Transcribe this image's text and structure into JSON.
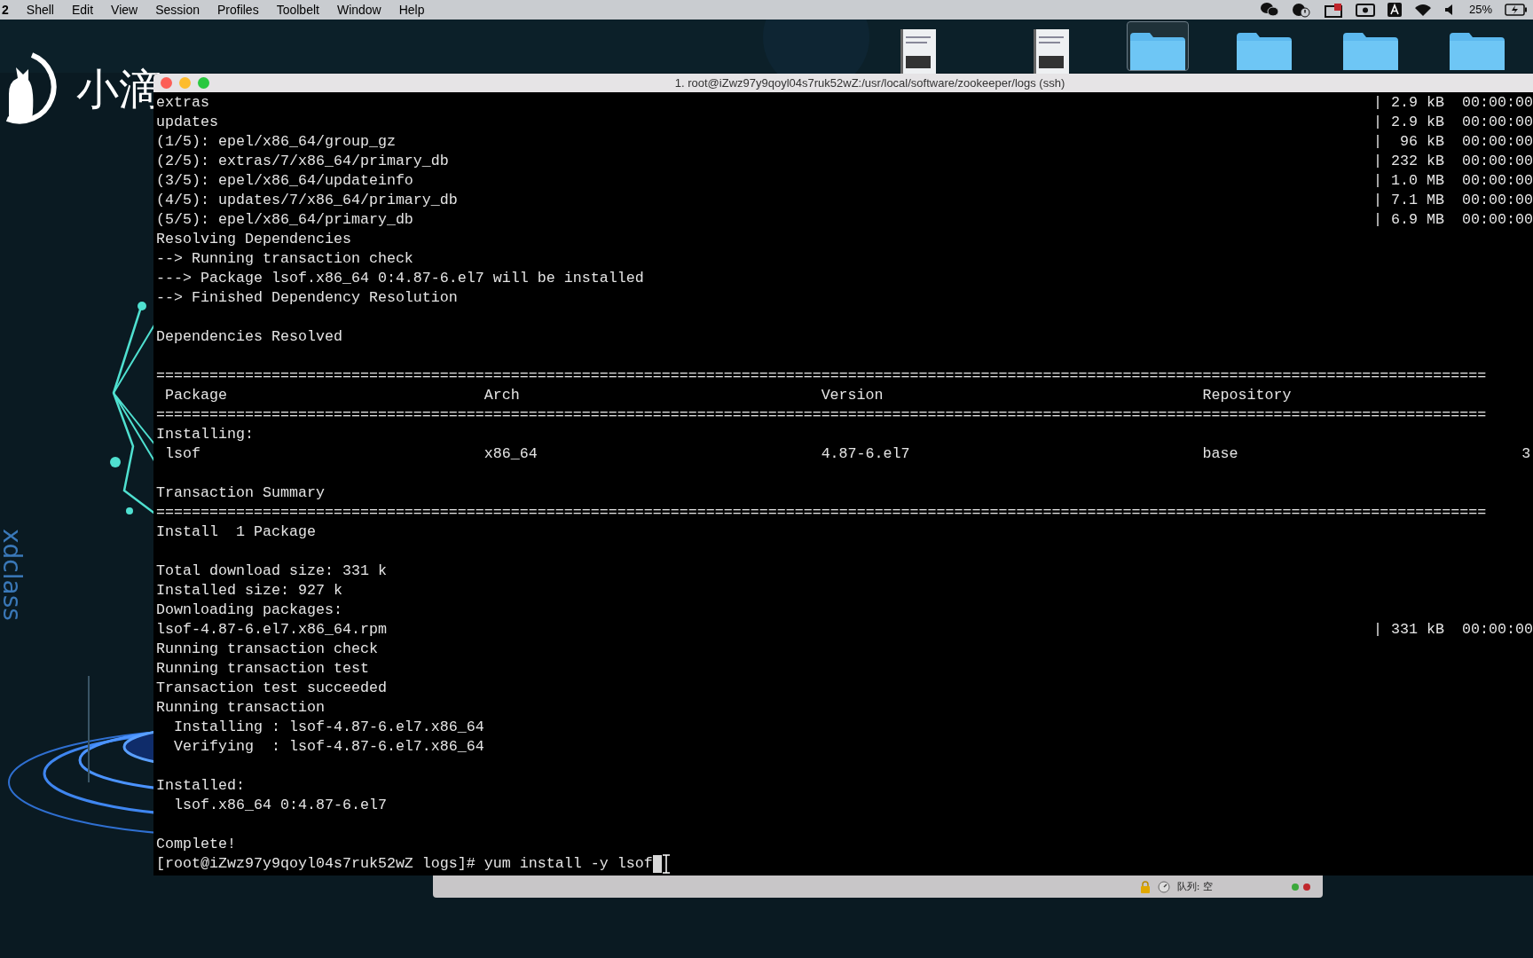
{
  "menu_bar": {
    "app_fragment": "2",
    "menus": [
      "Shell",
      "Edit",
      "View",
      "Session",
      "Profiles",
      "Toolbelt",
      "Window",
      "Help"
    ],
    "battery": "25%"
  },
  "desktop": {
    "logo_text": "小滴",
    "side_text": "xdclass",
    "icons": [
      {
        "kind": "document",
        "selected": false
      },
      {
        "kind": "document",
        "selected": false
      },
      {
        "kind": "folder",
        "selected": true
      },
      {
        "kind": "folder",
        "selected": false
      },
      {
        "kind": "folder",
        "selected": false
      },
      {
        "kind": "folder",
        "selected": false
      }
    ]
  },
  "terminal": {
    "title": "1. root@iZwz97y9qoyl04s7ruk52wZ:/usr/local/software/zookeeper/logs (ssh)",
    "lines": [
      {
        "kind": "text",
        "text": "extras",
        "right": "| 2.9 kB  00:00:00"
      },
      {
        "kind": "text",
        "text": "updates",
        "right": "| 2.9 kB  00:00:00"
      },
      {
        "kind": "text",
        "text": "(1/5): epel/x86_64/group_gz",
        "right": "|  96 kB  00:00:00"
      },
      {
        "kind": "text",
        "text": "(2/5): extras/7/x86_64/primary_db",
        "right": "| 232 kB  00:00:00"
      },
      {
        "kind": "text",
        "text": "(3/5): epel/x86_64/updateinfo",
        "right": "| 1.0 MB  00:00:00"
      },
      {
        "kind": "text",
        "text": "(4/5): updates/7/x86_64/primary_db",
        "right": "| 7.1 MB  00:00:00"
      },
      {
        "kind": "text",
        "text": "(5/5): epel/x86_64/primary_db",
        "right": "| 6.9 MB  00:00:00"
      },
      {
        "kind": "text",
        "text": "Resolving Dependencies"
      },
      {
        "kind": "text",
        "text": "--> Running transaction check"
      },
      {
        "kind": "text",
        "text": "---> Package lsof.x86_64 0:4.87-6.el7 will be installed"
      },
      {
        "kind": "text",
        "text": "--> Finished Dependency Resolution"
      },
      {
        "kind": "blank"
      },
      {
        "kind": "text",
        "text": "Dependencies Resolved"
      },
      {
        "kind": "blank"
      },
      {
        "kind": "text",
        "text": "======================================================================================================================================================"
      },
      {
        "kind": "row",
        "cells": [
          "Package",
          "Arch",
          "Version",
          "Repository"
        ]
      },
      {
        "kind": "text",
        "text": "======================================================================================================================================================"
      },
      {
        "kind": "text",
        "text": "Installing:"
      },
      {
        "kind": "row",
        "cells": [
          "lsof",
          "x86_64",
          "4.87-6.el7",
          "base",
          "3"
        ]
      },
      {
        "kind": "blank"
      },
      {
        "kind": "text",
        "text": "Transaction Summary"
      },
      {
        "kind": "text",
        "text": "======================================================================================================================================================"
      },
      {
        "kind": "text",
        "text": "Install  1 Package"
      },
      {
        "kind": "blank"
      },
      {
        "kind": "text",
        "text": "Total download size: 331 k"
      },
      {
        "kind": "text",
        "text": "Installed size: 927 k"
      },
      {
        "kind": "text",
        "text": "Downloading packages:"
      },
      {
        "kind": "text",
        "text": "lsof-4.87-6.el7.x86_64.rpm",
        "right": "| 331 kB  00:00:00"
      },
      {
        "kind": "text",
        "text": "Running transaction check"
      },
      {
        "kind": "text",
        "text": "Running transaction test"
      },
      {
        "kind": "text",
        "text": "Transaction test succeeded"
      },
      {
        "kind": "text",
        "text": "Running transaction"
      },
      {
        "kind": "text",
        "text": "  Installing : lsof-4.87-6.el7.x86_64"
      },
      {
        "kind": "text",
        "text": "  Verifying  : lsof-4.87-6.el7.x86_64"
      },
      {
        "kind": "blank"
      },
      {
        "kind": "text",
        "text": "Installed:"
      },
      {
        "kind": "text",
        "text": "  lsof.x86_64 0:4.87-6.el7"
      },
      {
        "kind": "blank"
      },
      {
        "kind": "text",
        "text": "Complete!"
      },
      {
        "kind": "prompt",
        "text": "[root@iZwz97y9qoyl04s7ruk52wZ logs]# yum install -y lsof"
      }
    ]
  },
  "queue_bar": {
    "label": "队列: 空"
  }
}
